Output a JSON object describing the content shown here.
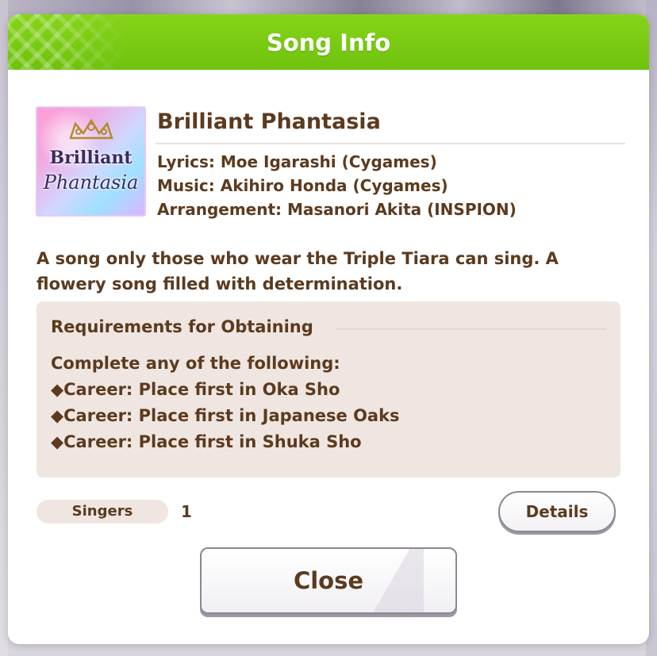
{
  "dialog": {
    "title": "Song Info",
    "accent_color": "#7cc715"
  },
  "song": {
    "jacket_line1": "Brilliant",
    "jacket_line2": "Phantasia",
    "title": "Brilliant Phantasia",
    "credits": [
      "Lyrics: Moe Igarashi (Cygames)",
      "Music: Akihiro Honda (Cygames)",
      "Arrangement: Masanori Akita (INSPION)"
    ],
    "description": "A song only those who wear the Triple Tiara can sing. A flowery song filled with determination."
  },
  "requirements": {
    "heading": "Requirements for Obtaining",
    "intro": "Complete any of the following:",
    "items": [
      "◆Career: Place first in Oka Sho",
      "◆Career: Place first in Japanese Oaks",
      "◆Career: Place first in Shuka Sho"
    ]
  },
  "singers": {
    "label": "Singers",
    "count": "1"
  },
  "buttons": {
    "details": "Details",
    "close": "Close"
  },
  "colors": {
    "text_brown": "#5c3a1e",
    "panel_beige": "#efe6e1"
  }
}
